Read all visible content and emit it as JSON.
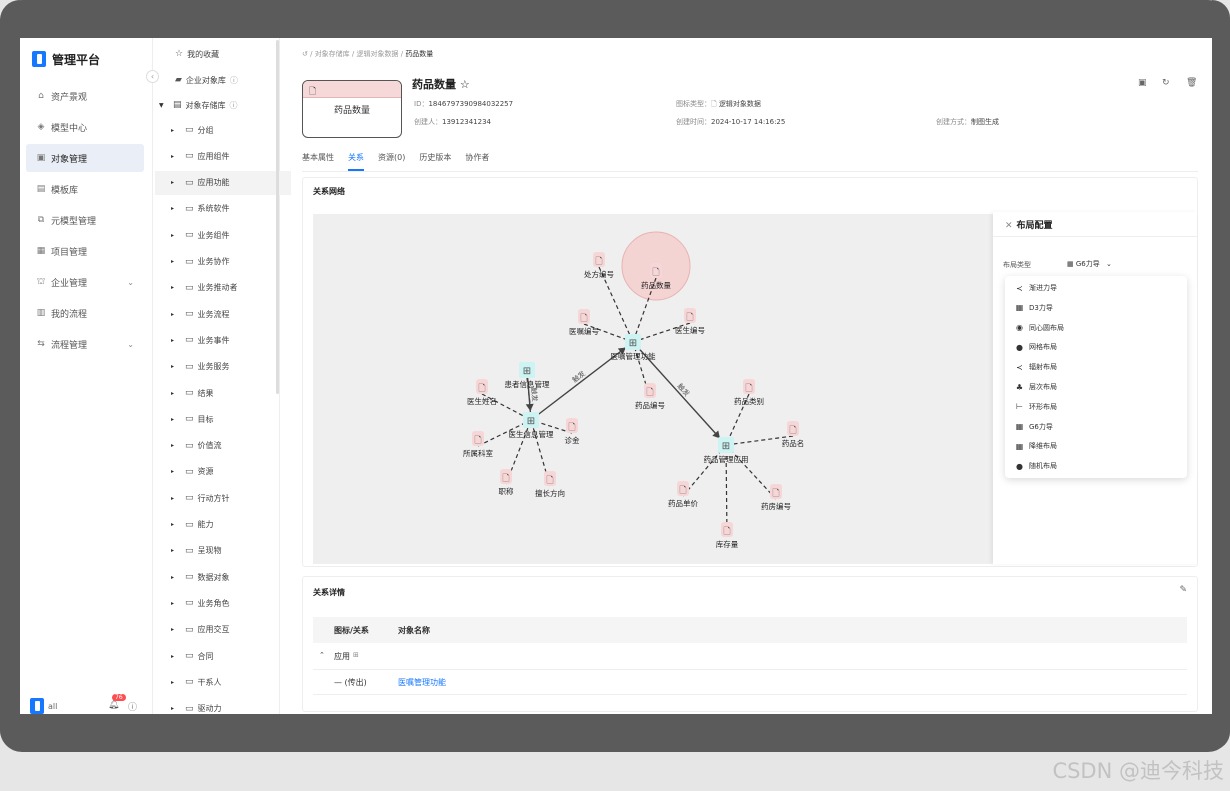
{
  "app": {
    "name": "管理平台"
  },
  "sidebar": {
    "items": [
      {
        "icon": "home-icon",
        "glyph": "⌂",
        "label": "资产景观"
      },
      {
        "icon": "model-icon",
        "glyph": "◈",
        "label": "模型中心"
      },
      {
        "icon": "object-icon",
        "glyph": "▣",
        "label": "对象管理",
        "active": true
      },
      {
        "icon": "template-icon",
        "glyph": "▤",
        "label": "模板库"
      },
      {
        "icon": "meta-model-icon",
        "glyph": "⧉",
        "label": "元模型管理"
      },
      {
        "icon": "project-icon",
        "glyph": "▦",
        "label": "项目管理"
      },
      {
        "icon": "enterprise-icon",
        "glyph": "⛫",
        "label": "企业管理",
        "chevron": true
      },
      {
        "icon": "flow-icon",
        "glyph": "▥",
        "label": "我的流程"
      },
      {
        "icon": "process-icon",
        "glyph": "⇆",
        "label": "流程管理",
        "chevron": true
      }
    ],
    "user": "all",
    "notification_count": "76"
  },
  "tree": {
    "favorites": "我的收藏",
    "enterprise_lib": "企业对象库",
    "object_lib": "对象存储库",
    "folders": [
      "分组",
      "应用组件",
      "应用功能",
      "系统软件",
      "业务组件",
      "业务协作",
      "业务推动者",
      "业务流程",
      "业务事件",
      "业务服务",
      "结果",
      "目标",
      "价值流",
      "资源",
      "行动方针",
      "能力",
      "呈现物",
      "数据对象",
      "业务角色",
      "应用交互",
      "合同",
      "干系人",
      "驱动力"
    ]
  },
  "breadcrumb": {
    "items": [
      "对象存储库",
      "逻辑对象数据",
      "药品数量"
    ]
  },
  "object": {
    "title": "药品数量",
    "thumb_label": "药品数量",
    "id_label": "ID：",
    "id": "1846797390984032257",
    "creator_label": "创建人：",
    "creator": "13912341234",
    "type_label": "图标类型：",
    "type": "逻辑对象数据",
    "created_label": "创建时间：",
    "created": "2024-10-17 14:16:25",
    "method_label": "创建方式：",
    "method": "制图生成"
  },
  "tabs": [
    "基本属性",
    "关系",
    "资源(0)",
    "历史版本",
    "协作者"
  ],
  "relation_network": {
    "title": "关系网络",
    "hubs": [
      {
        "label": "医嘱管理功能"
      },
      {
        "label": "医生信息管理"
      },
      {
        "label": "药品管理应用"
      },
      {
        "label": "患者信息管理"
      }
    ],
    "leaves": [
      {
        "label": "处方编号"
      },
      {
        "label": "药品数量"
      },
      {
        "label": "医嘱编号"
      },
      {
        "label": "医生编号"
      },
      {
        "label": "药品编号"
      },
      {
        "label": "医生姓名"
      },
      {
        "label": "所属科室"
      },
      {
        "label": "诊金"
      },
      {
        "label": "职称"
      },
      {
        "label": "擅长方向"
      },
      {
        "label": "药品类别"
      },
      {
        "label": "药品名"
      },
      {
        "label": "药品单价"
      },
      {
        "label": "药房编号"
      },
      {
        "label": "库存量"
      }
    ],
    "edge_labels": [
      "触发",
      "触发",
      "触发"
    ]
  },
  "layout_config": {
    "title": "布局配置",
    "type_label": "布局类型",
    "selected": "G6力导",
    "options": [
      {
        "icon": "share-icon",
        "glyph": "≺",
        "label": "渐进力导"
      },
      {
        "icon": "grid-icon",
        "glyph": "▦",
        "label": "D3力导"
      },
      {
        "icon": "concentric-icon",
        "glyph": "◉",
        "label": "同心圆布局"
      },
      {
        "icon": "mesh-icon",
        "glyph": "●",
        "label": "网格布局"
      },
      {
        "icon": "radial-icon",
        "glyph": "≺",
        "label": "辐射布局"
      },
      {
        "icon": "hierarchy-icon",
        "glyph": "♣",
        "label": "层次布局"
      },
      {
        "icon": "circle-layout-icon",
        "glyph": "⊢",
        "label": "环形布局"
      },
      {
        "icon": "grid-icon",
        "glyph": "▦",
        "label": "G6力导"
      },
      {
        "icon": "grid-icon",
        "glyph": "▦",
        "label": "降维布局"
      },
      {
        "icon": "random-icon",
        "glyph": "●",
        "label": "随机布局"
      }
    ]
  },
  "relation_detail": {
    "title": "关系详情",
    "columns": [
      "图标/关系",
      "对象名称"
    ],
    "group_label": "应用",
    "rows": [
      {
        "relation": "(传出)",
        "object": "医嘱管理功能"
      }
    ]
  },
  "watermark": "CSDN @迪今科技"
}
